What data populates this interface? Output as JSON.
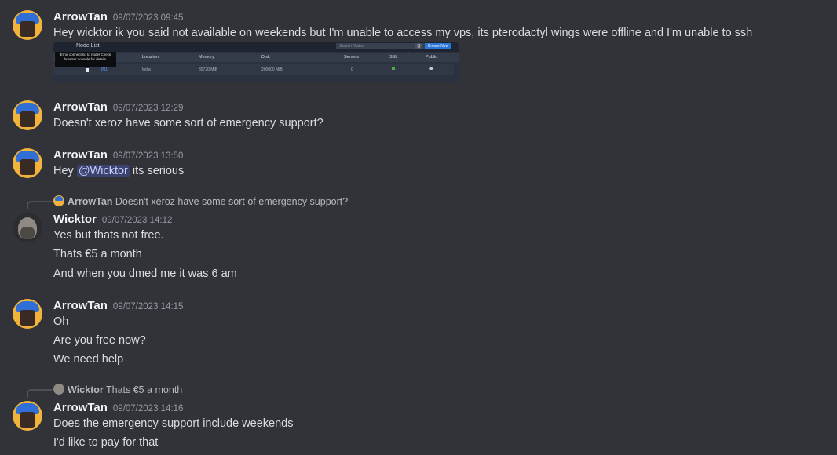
{
  "messages": [
    {
      "username": "ArrowTan",
      "timestamp": "09/07/2023 09:45",
      "avatar": "arrowtan-avatar",
      "lines": [
        "Hey wicktor ik you said not available on weekends but I'm unable to access my vps, its pterodactyl wings were offline and I'm unable to ssh"
      ],
      "attachment": {
        "title": "Node List",
        "search_placeholder": "Search Nodes",
        "search_button": "Q",
        "create_button": "Create New",
        "tooltip": "Error connecting to node! Check browser console for details.",
        "headers": [
          "Location",
          "Memory",
          "Disk",
          "Servers",
          "SSL",
          "Public"
        ],
        "row": [
          "IN1",
          "India",
          "30720 MiB",
          "200000 MiB",
          "0"
        ]
      }
    },
    {
      "username": "ArrowTan",
      "timestamp": "09/07/2023 12:29",
      "lines": [
        "Doesn't xeroz have some sort of emergency support?"
      ]
    },
    {
      "username": "ArrowTan",
      "timestamp": "09/07/2023 13:50",
      "line_prefix": "Hey",
      "mention": "@Wicktor",
      "line_suffix": "its serious"
    },
    {
      "reply_user": "ArrowTan",
      "reply_text": "Doesn't xeroz have some sort of emergency support?",
      "username": "Wicktor",
      "timestamp": "09/07/2023 14:12",
      "lines": [
        "Yes but thats not free.",
        "Thats €5 a month",
        "And when you dmed me it was 6 am"
      ]
    },
    {
      "username": "ArrowTan",
      "timestamp": "09/07/2023 14:15",
      "lines": [
        "Oh",
        "Are you free now?",
        "We need help"
      ]
    },
    {
      "reply_user": "Wicktor",
      "reply_text": "Thats €5 a month",
      "username": "ArrowTan",
      "timestamp": "09/07/2023 14:16",
      "lines": [
        "Does the emergency support include weekends",
        "I'd like to pay for that"
      ]
    }
  ],
  "colors": {
    "background": "#313338",
    "mention_bg": "#3c4270",
    "username": "#f2f3f5",
    "timestamp": "#949ba4"
  }
}
